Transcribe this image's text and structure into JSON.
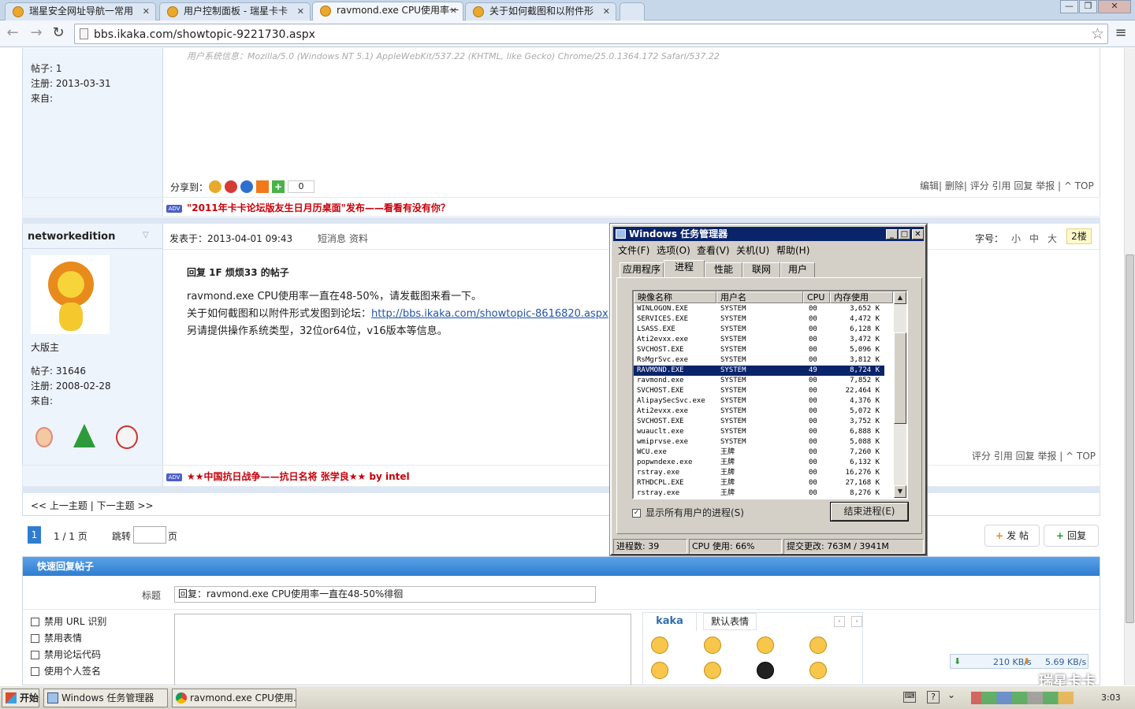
{
  "browser": {
    "tabs": [
      {
        "label": "瑞星安全网址导航一常用"
      },
      {
        "label": "用户控制面板 - 瑞星卡卡"
      },
      {
        "label": "ravmond.exe CPU使用率一"
      },
      {
        "label": "关于如何截图和以附件形"
      }
    ],
    "url": "bbs.ikaka.com/showtopic-9221730.aspx"
  },
  "post1": {
    "sysinfo": "用户系统信息：Mozilla/5.0 (Windows NT 5.1) AppleWebKit/537.22 (KHTML, like Gecko) Chrome/25.0.1364.172 Safari/537.22",
    "stats": [
      "帖子: 1",
      "注册: 2013-03-31",
      "来自:"
    ],
    "share_label": "分享到：",
    "share_count": "0",
    "actions": "编辑| 删除| 评分 引用 回复 举报 | ^ TOP",
    "ad_text": "\"2011年卡卡论坛版友生日月历桌面\"发布——看看有没有你？"
  },
  "post2": {
    "author": "networkedition",
    "posted_label": "发表于：",
    "posted_at": "2013-04-01 09:43",
    "pm": "短消息",
    "profile": "资料",
    "font_label": "字号：",
    "font_sizes": [
      "小",
      "中",
      "大"
    ],
    "floor": "2楼",
    "rank": "大版主",
    "stats": [
      "帖子: 31646",
      "注册: 2008-02-28",
      "来自:"
    ],
    "reply_title": "回复 1F 烦烦33 的帖子",
    "line1": "ravmond.exe CPU使用率一直在48-50%，请发截图来看一下。",
    "line2_prefix": "关于如何截图和以附件形式发图到论坛：",
    "line2_link": "http://bbs.ikaka.com/showtopic-8616820.aspx",
    "line3": "另请提供操作系统类型，32位or64位，v16版本等信息。",
    "actions": "评分 引用 回复 举报 | ^ TOP",
    "ad_text": "★★中国抗日战争——抗日名将 张学良★★ by intel"
  },
  "nav": {
    "prev": "<< 上一主题",
    "sep": "|",
    "next": "下一主题 >>"
  },
  "pager": {
    "current": "1",
    "total": "1 / 1 页",
    "jump": "跳转",
    "page": "页"
  },
  "post_buttons": {
    "new": "发 帖",
    "reply": "回复"
  },
  "quick_reply": {
    "title": "快速回复帖子",
    "subject_label": "标题",
    "subject_value": "回复：ravmond.exe CPU使用率一直在48-50%徘徊",
    "options": [
      "禁用 URL 识别",
      "禁用表情",
      "禁用论坛代码",
      "使用个人签名"
    ],
    "emoji_tabs": [
      "kaka",
      "默认表情"
    ]
  },
  "speed": {
    "down": "210 KB/s",
    "up": "5.69 KB/s"
  },
  "watermark": "瑞星卡卡",
  "taskmgr": {
    "title": "Windows 任务管理器",
    "menu": [
      "文件(F)",
      "选项(O)",
      "查看(V)",
      "关机(U)",
      "帮助(H)"
    ],
    "tabs": [
      "应用程序",
      "进程",
      "性能",
      "联网",
      "用户"
    ],
    "columns": [
      "映像名称",
      "用户名",
      "CPU",
      "内存使用"
    ],
    "processes": [
      [
        "WINLOGON.EXE",
        "SYSTEM",
        "00",
        "3,652 K"
      ],
      [
        "SERVICES.EXE",
        "SYSTEM",
        "00",
        "4,472 K"
      ],
      [
        "LSASS.EXE",
        "SYSTEM",
        "00",
        "6,128 K"
      ],
      [
        "Ati2evxx.exe",
        "SYSTEM",
        "00",
        "3,472 K"
      ],
      [
        "SVCHOST.EXE",
        "SYSTEM",
        "00",
        "5,096 K"
      ],
      [
        "RsMgrSvc.exe",
        "SYSTEM",
        "00",
        "3,812 K"
      ],
      [
        "RAVMOND.EXE",
        "SYSTEM",
        "49",
        "8,724 K"
      ],
      [
        "ravmond.exe",
        "SYSTEM",
        "00",
        "7,852 K"
      ],
      [
        "SVCHOST.EXE",
        "SYSTEM",
        "00",
        "22,464 K"
      ],
      [
        "AlipaySecSvc.exe",
        "SYSTEM",
        "00",
        "4,376 K"
      ],
      [
        "Ati2evxx.exe",
        "SYSTEM",
        "00",
        "5,072 K"
      ],
      [
        "SVCHOST.EXE",
        "SYSTEM",
        "00",
        "3,752 K"
      ],
      [
        "wuauclt.exe",
        "SYSTEM",
        "00",
        "6,888 K"
      ],
      [
        "wmiprvse.exe",
        "SYSTEM",
        "00",
        "5,088 K"
      ],
      [
        "WCU.exe",
        "王牌",
        "00",
        "7,260 K"
      ],
      [
        "popwndexe.exe",
        "王牌",
        "00",
        "6,132 K"
      ],
      [
        "rstray.exe",
        "王牌",
        "00",
        "16,276 K"
      ],
      [
        "RTHDCPL.EXE",
        "王牌",
        "00",
        "27,168 K"
      ],
      [
        "rstray.exe",
        "王牌",
        "00",
        "8,276 K"
      ]
    ],
    "selected_index": 6,
    "show_all_label": "显示所有用户的进程(S)",
    "end_button": "结束进程(E)",
    "status": [
      "进程数: 39",
      "CPU 使用: 66%",
      "提交更改: 763M / 3941M"
    ]
  },
  "taskbar": {
    "start": "开始",
    "items": [
      "Windows 任务管理器",
      "ravmond.exe CPU使用..."
    ],
    "clock": "3:03"
  }
}
